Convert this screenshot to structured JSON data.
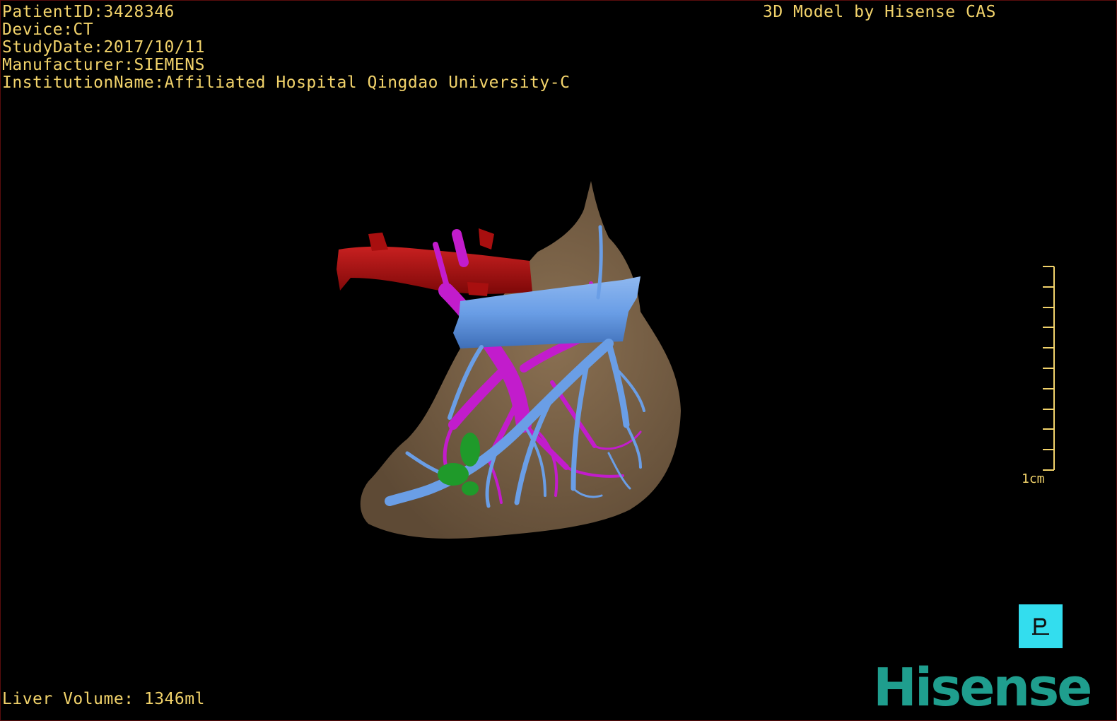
{
  "patient": {
    "id_line": "PatientID:3428346",
    "device_line": "Device:CT",
    "study_date_line": "StudyDate:2017/10/11",
    "manufacturer_line": "Manufacturer:SIEMENS",
    "institution_line": "InstitutionName:Affiliated Hospital Qingdao University-C"
  },
  "credit": "3D Model by Hisense CAS",
  "liver_volume": "Liver Volume: 1346ml",
  "scale_bar": {
    "label": "1cm"
  },
  "orientation": {
    "label": "P"
  },
  "brand": "Hisense",
  "colors": {
    "overlay_text": "#f2d36b",
    "liver": "#7a6247",
    "hepatic_artery": "#a80f0f",
    "portal_vein": "#c21ccc",
    "hepatic_vein": "#6a9ee6",
    "lesion": "#1f9a2a",
    "orientation_cube": "#33ddee",
    "brand": "#1f9e8e"
  }
}
